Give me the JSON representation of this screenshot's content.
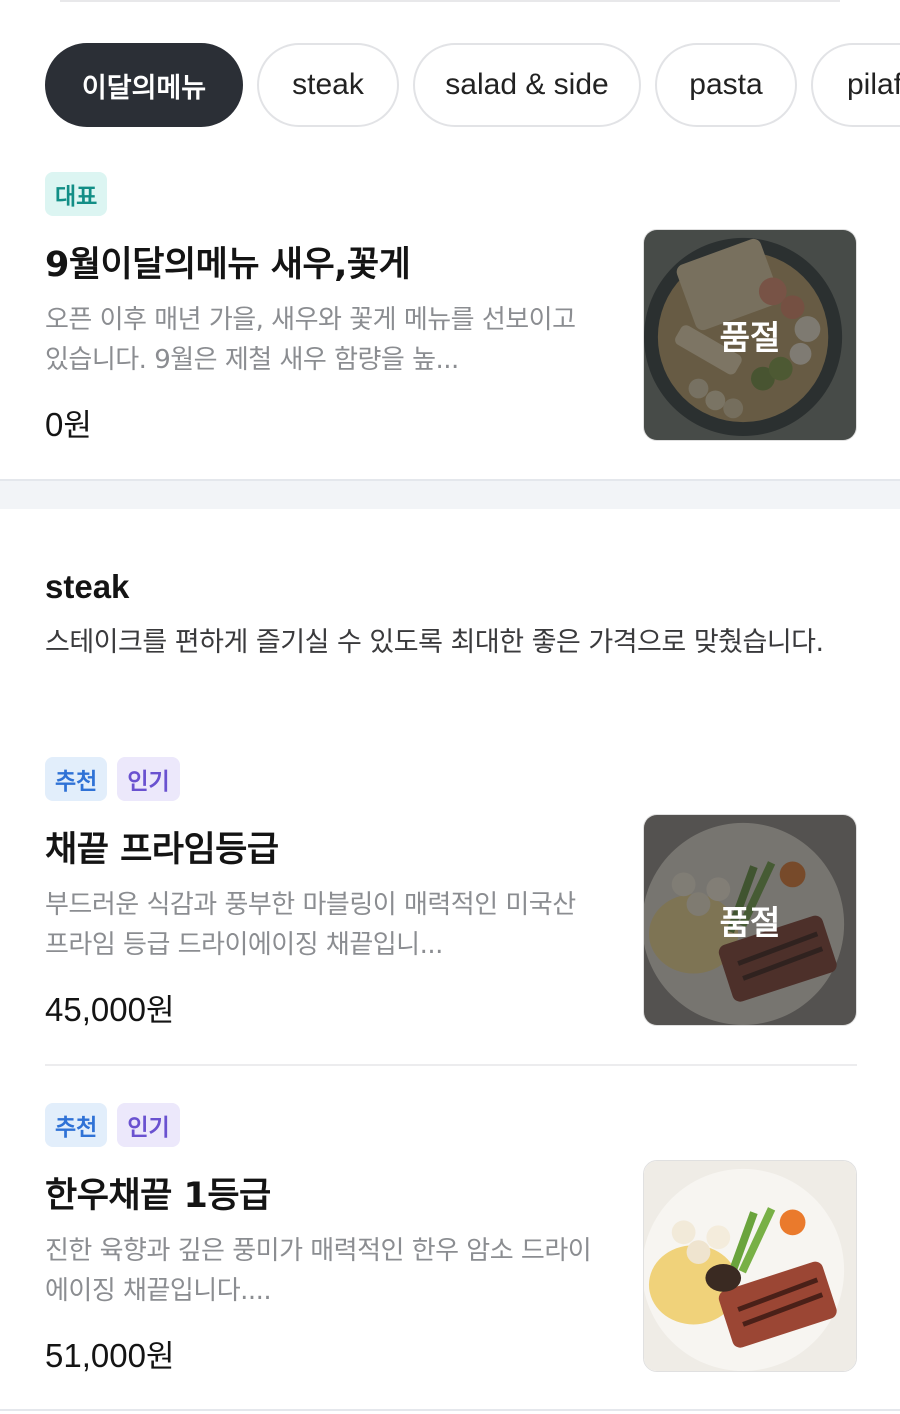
{
  "tabs": [
    {
      "label": "이달의메뉴",
      "active": true
    },
    {
      "label": "steak",
      "active": false
    },
    {
      "label": "salad & side",
      "active": false
    },
    {
      "label": "pasta",
      "active": false
    },
    {
      "label": "pilaf",
      "active": false
    }
  ],
  "featured": {
    "badges": [
      "대표"
    ],
    "name": "9월이달의메뉴 새우,꽃게",
    "description": "오픈 이후 매년 가을, 새우와 꽃게 메뉴를 선보이고 있습니다. 9월은 제철 새우 함량을 높...",
    "price": "0",
    "currency": "원",
    "soldout_label": "품절"
  },
  "steak_section": {
    "title": "steak",
    "description": "스테이크를 편하게 즐기실 수 있도록 최대한 좋은 가격으로 맞췄습니다."
  },
  "items": [
    {
      "badges": [
        "추천",
        "인기"
      ],
      "name": "채끝 프라임등급",
      "description": "부드러운 식감과 풍부한 마블링이 매력적인 미국산 프라임 등급 드라이에이징 채끝입니...",
      "price": "45,000",
      "currency": "원",
      "soldout_label": "품절"
    },
    {
      "badges": [
        "추천",
        "인기"
      ],
      "name": "한우채끝 1등급",
      "description": "진한 육향과 깊은 풍미가 매력적인 한우 암소 드라이에이징 채끝입니다....",
      "price": "51,000",
      "currency": "원"
    }
  ],
  "colors": {
    "active_tab": "#2b2f36",
    "badge_rep": "#128e86",
    "badge_rec": "#2f72d6",
    "badge_pop": "#6a52d0"
  }
}
